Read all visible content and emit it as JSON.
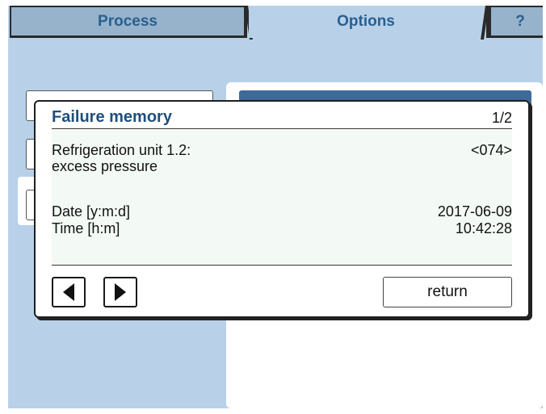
{
  "tabs": {
    "process": "Process",
    "options": "Options",
    "help": "?"
  },
  "dialog": {
    "title": "Failure memory",
    "page_indicator": "1/2",
    "failure_line1": "Refrigeration unit 1.2:",
    "failure_line2": "excess pressure",
    "failure_code": "<074>",
    "date_label": "Date [y:m:d]",
    "date_value": "2017-06-09",
    "time_label": "Time [h:m]",
    "time_value": "10:42:28",
    "prev_icon": "triangle-left-icon",
    "next_icon": "triangle-right-icon",
    "return_label": "return"
  },
  "colors": {
    "background": "#b8d1e9",
    "accent_text": "#1f4f7e",
    "tab_inactive": "#97b3cc"
  }
}
